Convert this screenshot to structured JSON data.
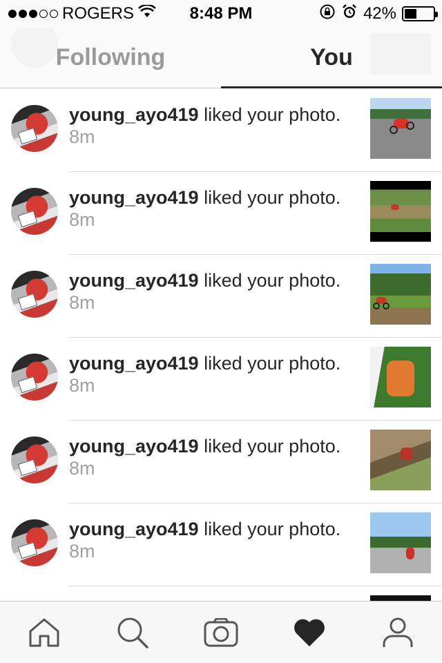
{
  "status_bar": {
    "carrier": "ROGERS",
    "time": "8:48 PM",
    "battery_percent": "42%",
    "battery_level": 0.42,
    "signal_bars_filled": 3,
    "signal_bars_total": 5,
    "icons": [
      "wifi-icon",
      "rotation-lock-icon",
      "alarm-icon",
      "battery-icon"
    ]
  },
  "header": {
    "tabs": [
      {
        "label": "Following",
        "active": false
      },
      {
        "label": "You",
        "active": true
      }
    ]
  },
  "activity": [
    {
      "username": "young_ayo419",
      "action": "liked your",
      "action2": "photo.",
      "time": "8m"
    },
    {
      "username": "young_ayo419",
      "action": "liked your",
      "action2": "photo.",
      "time": "8m"
    },
    {
      "username": "young_ayo419",
      "action": "liked your",
      "action2": "photo.",
      "time": "8m"
    },
    {
      "username": "young_ayo419",
      "action": "liked your",
      "action2": "photo.",
      "time": "8m"
    },
    {
      "username": "young_ayo419",
      "action": "liked your",
      "action2": "photo.",
      "time": "8m"
    },
    {
      "username": "young_ayo419",
      "action": "liked your",
      "action2": "photo.",
      "time": "8m"
    }
  ],
  "tab_bar": {
    "items": [
      "home-icon",
      "search-icon",
      "camera-icon",
      "heart-icon",
      "profile-icon"
    ],
    "active": "heart-icon"
  }
}
